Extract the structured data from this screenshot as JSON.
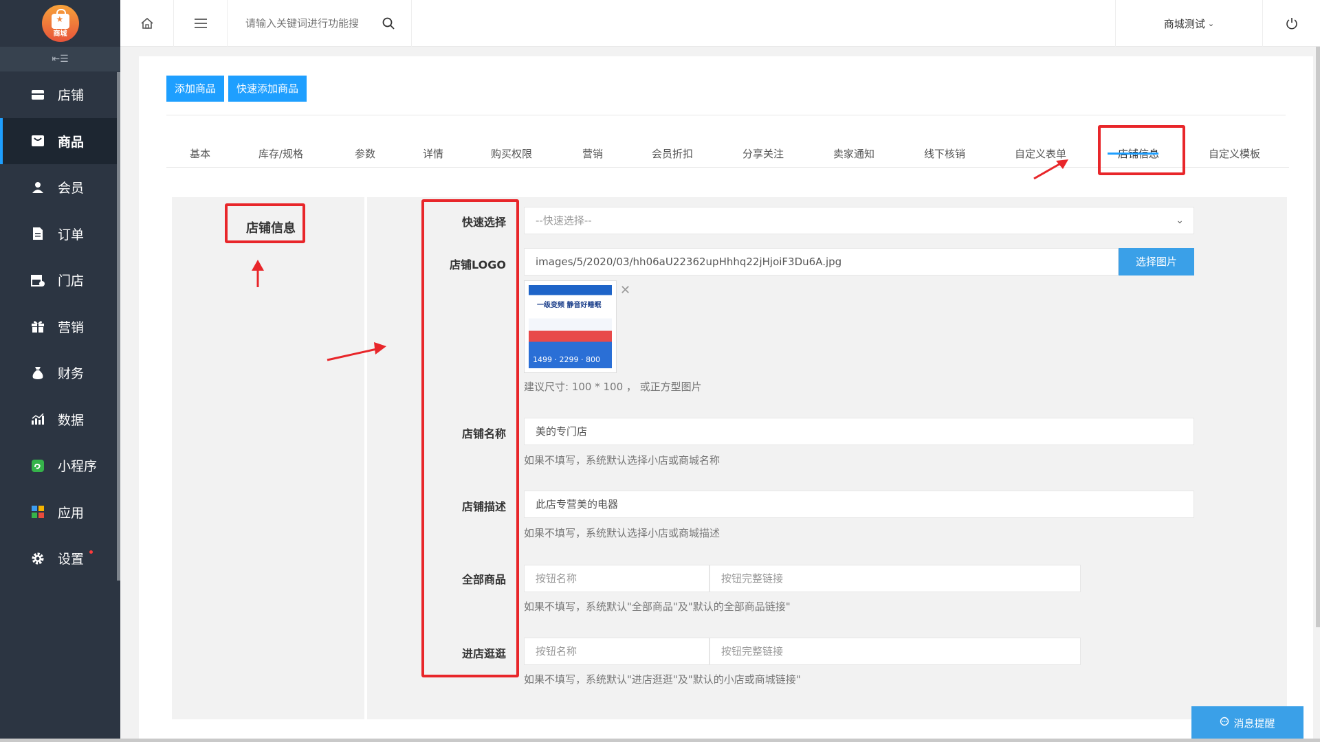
{
  "sidebar": {
    "logo_text": "商城",
    "items": [
      {
        "label": "店铺",
        "icon": "store-icon"
      },
      {
        "label": "商品",
        "icon": "goods-icon"
      },
      {
        "label": "会员",
        "icon": "user-icon"
      },
      {
        "label": "订单",
        "icon": "order-icon"
      },
      {
        "label": "门店",
        "icon": "shop-icon"
      },
      {
        "label": "营销",
        "icon": "gift-icon"
      },
      {
        "label": "财务",
        "icon": "money-bag-icon"
      },
      {
        "label": "数据",
        "icon": "chart-icon"
      },
      {
        "label": "小程序",
        "icon": "miniprogram-icon"
      },
      {
        "label": "应用",
        "icon": "apps-icon"
      },
      {
        "label": "设置",
        "icon": "gear-icon"
      }
    ]
  },
  "topbar": {
    "search_placeholder": "请输入关键词进行功能搜",
    "user_label": "商城测试"
  },
  "toolbar": {
    "add_product": "添加商品",
    "quick_add_product": "快速添加商品"
  },
  "tabs": [
    "基本",
    "库存/规格",
    "参数",
    "详情",
    "购买权限",
    "营销",
    "会员折扣",
    "分享关注",
    "卖家通知",
    "线下核销",
    "自定义表单",
    "店铺信息",
    "自定义模板"
  ],
  "section_title": "店铺信息",
  "form": {
    "quick_select": {
      "label": "快速选择",
      "placeholder": "--快速选择--"
    },
    "logo": {
      "label": "店铺LOGO",
      "value": "images/5/2020/03/hh06aU22362upHhhq22jHjoiF3Du6A.jpg",
      "button": "选择图片",
      "hint": "建议尺寸: 100 * 100 ， 或正方型图片",
      "thumb_headline": "一级变频 静音好睡眠",
      "thumb_price": "1499 · 2299 · 800"
    },
    "name": {
      "label": "店铺名称",
      "value": "美的专门店",
      "hint": "如果不填写，系统默认选择小店或商城名称"
    },
    "desc": {
      "label": "店铺描述",
      "value": "此店专营美的电器",
      "hint": "如果不填写，系统默认选择小店或商城描述"
    },
    "all_goods": {
      "label": "全部商品",
      "name_placeholder": "按钮名称",
      "link_placeholder": "按钮完整链接",
      "hint": "如果不填写，系统默认\"全部商品\"及\"默认的全部商品链接\""
    },
    "visit_shop": {
      "label": "进店逛逛",
      "name_placeholder": "按钮名称",
      "link_placeholder": "按钮完整链接",
      "hint": "如果不填写，系统默认\"进店逛逛\"及\"默认的小店或商城链接\""
    }
  },
  "message_button": "消息提醒"
}
